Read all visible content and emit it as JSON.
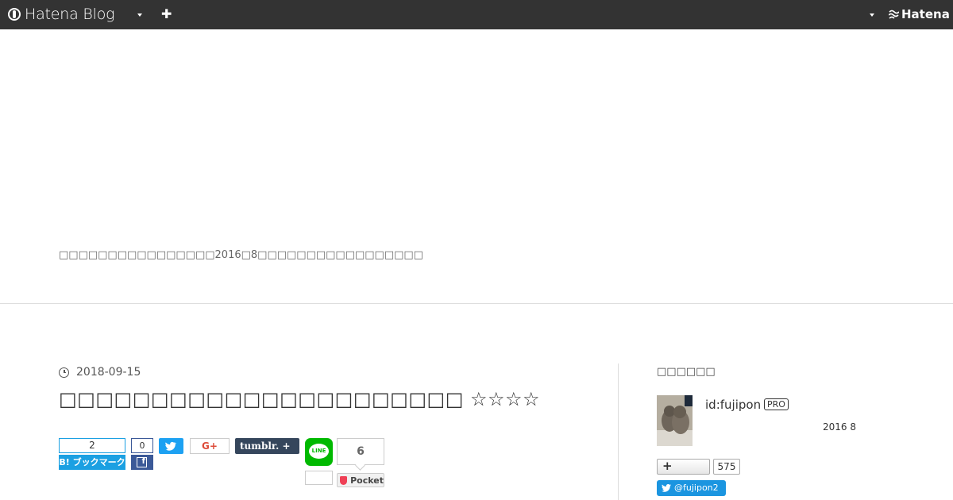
{
  "header": {
    "logo_text": "Hatena Blog",
    "hatena_text": "Hatena"
  },
  "blog": {
    "description": "□□□□□□□□□□□□□□□□2016□8□□□□□□□□□□□□□□□□□"
  },
  "entry": {
    "date": "2018-09-15",
    "title": "□□□□□□□□□□□□□□□□□□□□□□ ☆☆☆☆"
  },
  "share": {
    "hatena_count": "2",
    "hatena_label": "B! ブックマーク",
    "facebook_count": "0",
    "gplus_label": "G+",
    "tumblr_label": "tumblr.  +",
    "line_label": "LINE",
    "pocket_count": "6",
    "pocket_label": "Pocket"
  },
  "sidebar": {
    "title": "□□□□□□",
    "user_id": "id:fujipon",
    "pro_badge": "PRO",
    "since": "2016  8",
    "follow_label": "+",
    "follow_count": "575",
    "twitter_handle": "@fujipon2"
  },
  "colors": {
    "header_bg": "#333333",
    "hatena_blue": "#1ba0e2",
    "facebook": "#3b5998",
    "twitter": "#1da1f2",
    "tumblr": "#35465c",
    "line": "#00b900",
    "pocket": "#ef4056"
  }
}
